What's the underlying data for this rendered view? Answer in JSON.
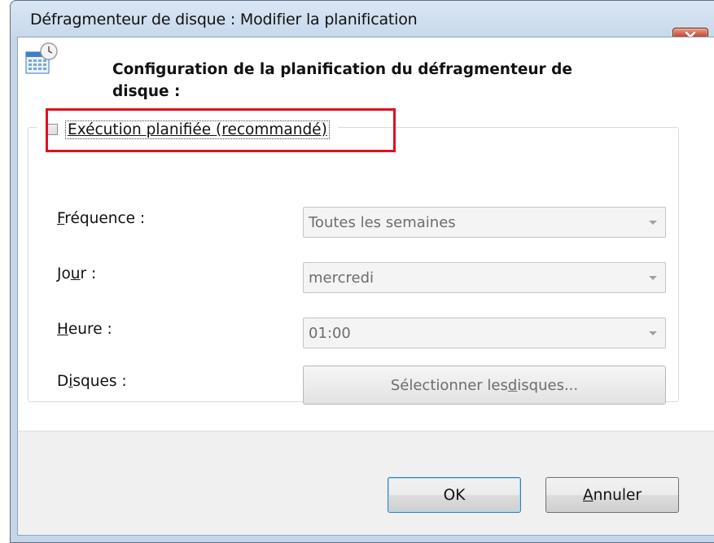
{
  "window": {
    "title": "Défragmenteur de disque : Modifier la planification"
  },
  "header": {
    "text": "Configuration de la planification du défragmenteur de disque :"
  },
  "schedule_checkbox": {
    "label": "Exécution planifiée (recommandé)",
    "checked": false
  },
  "fields": {
    "frequency": {
      "label_pre": "",
      "label_key": "F",
      "label_post": "réquence :",
      "value": "Toutes les semaines"
    },
    "day": {
      "label_pre": "Jo",
      "label_key": "u",
      "label_post": "r :",
      "value": "mercredi"
    },
    "time": {
      "label_pre": "",
      "label_key": "H",
      "label_post": "eure :",
      "value": "01:00"
    },
    "disks": {
      "label_pre": "D",
      "label_key": "i",
      "label_post": "sques :",
      "button_pre": "Sélectionner les ",
      "button_key": "d",
      "button_post": "isques..."
    }
  },
  "buttons": {
    "ok": "OK",
    "cancel_key": "A",
    "cancel_rest": "nnuler"
  },
  "colors": {
    "highlight": "#e0101e",
    "close_button": "#c7452c"
  },
  "icons": {
    "header": "calendar-clock-icon",
    "close": "close-icon"
  }
}
